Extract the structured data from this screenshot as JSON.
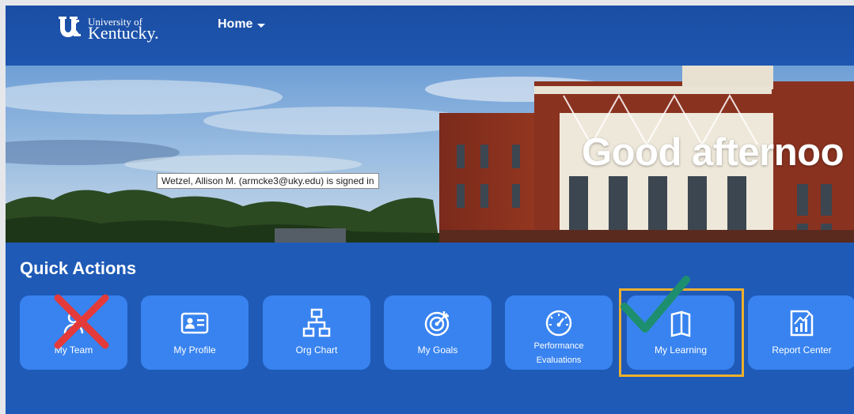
{
  "header": {
    "logo_line1": "University of",
    "logo_line2": "Kentucky.",
    "home_label": "Home"
  },
  "hero": {
    "greeting": "Good afternoo",
    "signed_in_tooltip": "Wetzel, Allison M. (armcke3@uky.edu) is signed in"
  },
  "quick_actions": {
    "title": "Quick Actions",
    "tiles": [
      {
        "label": "My Team",
        "icon": "team-icon"
      },
      {
        "label": "My Profile",
        "icon": "profile-card-icon"
      },
      {
        "label": "Org Chart",
        "icon": "org-chart-icon"
      },
      {
        "label": "My Goals",
        "icon": "goal-target-icon"
      },
      {
        "label_line1": "Performance",
        "label_line2": "Evaluations",
        "icon": "gauge-icon"
      },
      {
        "label": "My Learning",
        "icon": "book-icon"
      },
      {
        "label": "Report Center",
        "icon": "report-chart-icon"
      }
    ]
  },
  "annotations": {
    "cross_color": "#e53a3a",
    "check_color": "#1e8f6e",
    "highlight_color": "#efb02c"
  },
  "colors": {
    "page_background": "#1f5ab7",
    "tile_background": "#3883ef"
  }
}
